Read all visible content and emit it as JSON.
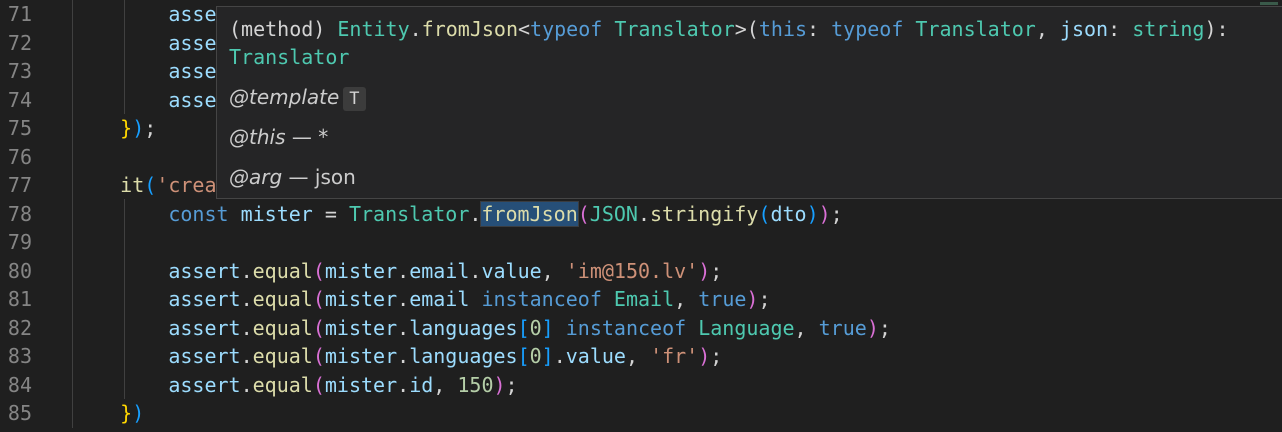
{
  "editor": {
    "lines": [
      {
        "n": "71",
        "tokens": [
          [
            "var",
            "asse"
          ]
        ],
        "indent": "        "
      },
      {
        "n": "72",
        "tokens": [
          [
            "var",
            "asse"
          ]
        ],
        "indent": "        "
      },
      {
        "n": "73",
        "tokens": [
          [
            "var",
            "asse"
          ]
        ],
        "indent": "        "
      },
      {
        "n": "74",
        "tokens": [
          [
            "var",
            "asse"
          ]
        ],
        "indent": "        "
      },
      {
        "n": "75",
        "tokens": [
          [
            "b1",
            "}"
          ],
          [
            "b3",
            ")"
          ],
          [
            "pn",
            ";"
          ]
        ],
        "indent": "    "
      },
      {
        "n": "76",
        "tokens": [],
        "indent": ""
      },
      {
        "n": "77",
        "tokens": [
          [
            "fn",
            "it"
          ],
          [
            "b3",
            "("
          ],
          [
            "str",
            "'crea"
          ]
        ],
        "indent": "    "
      },
      {
        "n": "78",
        "tokens": [
          [
            "kw",
            "const "
          ],
          [
            "var",
            "mister"
          ],
          [
            "pn",
            " = "
          ],
          [
            "type",
            "Translator"
          ],
          [
            "pn",
            "."
          ],
          [
            "fn hl",
            "fromJson"
          ],
          [
            "b2",
            "("
          ],
          [
            "type",
            "JSON"
          ],
          [
            "pn",
            "."
          ],
          [
            "fn",
            "stringify"
          ],
          [
            "b3",
            "("
          ],
          [
            "var",
            "dto"
          ],
          [
            "b3",
            ")"
          ],
          [
            "b2",
            ")"
          ],
          [
            "pn",
            ";"
          ]
        ],
        "indent": "        "
      },
      {
        "n": "79",
        "tokens": [],
        "indent": ""
      },
      {
        "n": "80",
        "tokens": [
          [
            "var",
            "assert"
          ],
          [
            "pn",
            "."
          ],
          [
            "fn",
            "equal"
          ],
          [
            "b2",
            "("
          ],
          [
            "var",
            "mister"
          ],
          [
            "pn",
            "."
          ],
          [
            "var",
            "email"
          ],
          [
            "pn",
            "."
          ],
          [
            "var",
            "value"
          ],
          [
            "pn",
            ", "
          ],
          [
            "str",
            "'im@150.lv'"
          ],
          [
            "b2",
            ")"
          ],
          [
            "pn",
            ";"
          ]
        ],
        "indent": "        "
      },
      {
        "n": "81",
        "tokens": [
          [
            "var",
            "assert"
          ],
          [
            "pn",
            "."
          ],
          [
            "fn",
            "equal"
          ],
          [
            "b2",
            "("
          ],
          [
            "var",
            "mister"
          ],
          [
            "pn",
            "."
          ],
          [
            "var",
            "email"
          ],
          [
            "pn",
            " "
          ],
          [
            "kw",
            "instanceof"
          ],
          [
            "pn",
            " "
          ],
          [
            "type",
            "Email"
          ],
          [
            "pn",
            ", "
          ],
          [
            "kw",
            "true"
          ],
          [
            "b2",
            ")"
          ],
          [
            "pn",
            ";"
          ]
        ],
        "indent": "        "
      },
      {
        "n": "82",
        "tokens": [
          [
            "var",
            "assert"
          ],
          [
            "pn",
            "."
          ],
          [
            "fn",
            "equal"
          ],
          [
            "b2",
            "("
          ],
          [
            "var",
            "mister"
          ],
          [
            "pn",
            "."
          ],
          [
            "var",
            "languages"
          ],
          [
            "b3",
            "["
          ],
          [
            "num",
            "0"
          ],
          [
            "b3",
            "]"
          ],
          [
            "pn",
            " "
          ],
          [
            "kw",
            "instanceof"
          ],
          [
            "pn",
            " "
          ],
          [
            "type",
            "Language"
          ],
          [
            "pn",
            ", "
          ],
          [
            "kw",
            "true"
          ],
          [
            "b2",
            ")"
          ],
          [
            "pn",
            ";"
          ]
        ],
        "indent": "        "
      },
      {
        "n": "83",
        "tokens": [
          [
            "var",
            "assert"
          ],
          [
            "pn",
            "."
          ],
          [
            "fn",
            "equal"
          ],
          [
            "b2",
            "("
          ],
          [
            "var",
            "mister"
          ],
          [
            "pn",
            "."
          ],
          [
            "var",
            "languages"
          ],
          [
            "b3",
            "["
          ],
          [
            "num",
            "0"
          ],
          [
            "b3",
            "]"
          ],
          [
            "pn",
            "."
          ],
          [
            "var",
            "value"
          ],
          [
            "pn",
            ", "
          ],
          [
            "str",
            "'fr'"
          ],
          [
            "b2",
            ")"
          ],
          [
            "pn",
            ";"
          ]
        ],
        "indent": "        "
      },
      {
        "n": "84",
        "tokens": [
          [
            "var",
            "assert"
          ],
          [
            "pn",
            "."
          ],
          [
            "fn",
            "equal"
          ],
          [
            "b2",
            "("
          ],
          [
            "var",
            "mister"
          ],
          [
            "pn",
            "."
          ],
          [
            "var",
            "id"
          ],
          [
            "pn",
            ", "
          ],
          [
            "num",
            "150"
          ],
          [
            "b2",
            ")"
          ],
          [
            "pn",
            ";"
          ]
        ],
        "indent": "        "
      },
      {
        "n": "85",
        "tokens": [
          [
            "b1",
            "}"
          ],
          [
            "b3",
            ")"
          ]
        ],
        "indent": "    "
      }
    ]
  },
  "hover": {
    "signature_parts": [
      [
        "pn",
        "(method) "
      ],
      [
        "type",
        "Entity"
      ],
      [
        "pn",
        "."
      ],
      [
        "fn",
        "fromJson"
      ],
      [
        "pn",
        "<"
      ],
      [
        "kw",
        "typeof"
      ],
      [
        "pn",
        " "
      ],
      [
        "type",
        "Translator"
      ],
      [
        "pn",
        ">("
      ],
      [
        "kw",
        "this"
      ],
      [
        "pn",
        ": "
      ],
      [
        "kw",
        "typeof"
      ],
      [
        "pn",
        " "
      ],
      [
        "type",
        "Translator"
      ],
      [
        "pn",
        ", "
      ],
      [
        "var",
        "json"
      ],
      [
        "pn",
        ": "
      ],
      [
        "type",
        "string"
      ],
      [
        "pn",
        "):"
      ]
    ],
    "return_type": "Translator",
    "template_tag": "@template",
    "template_param": "T",
    "this_tag": "@this",
    "this_desc": "— *",
    "arg_tag": "@arg",
    "arg_desc": "— json"
  },
  "colors": {
    "background": "#1f1f1f",
    "keyword": "#569cd6",
    "variable": "#9cdcfe",
    "function": "#dcdcaa",
    "type": "#4ec9b0",
    "string": "#ce9178",
    "number": "#b5cea8"
  }
}
